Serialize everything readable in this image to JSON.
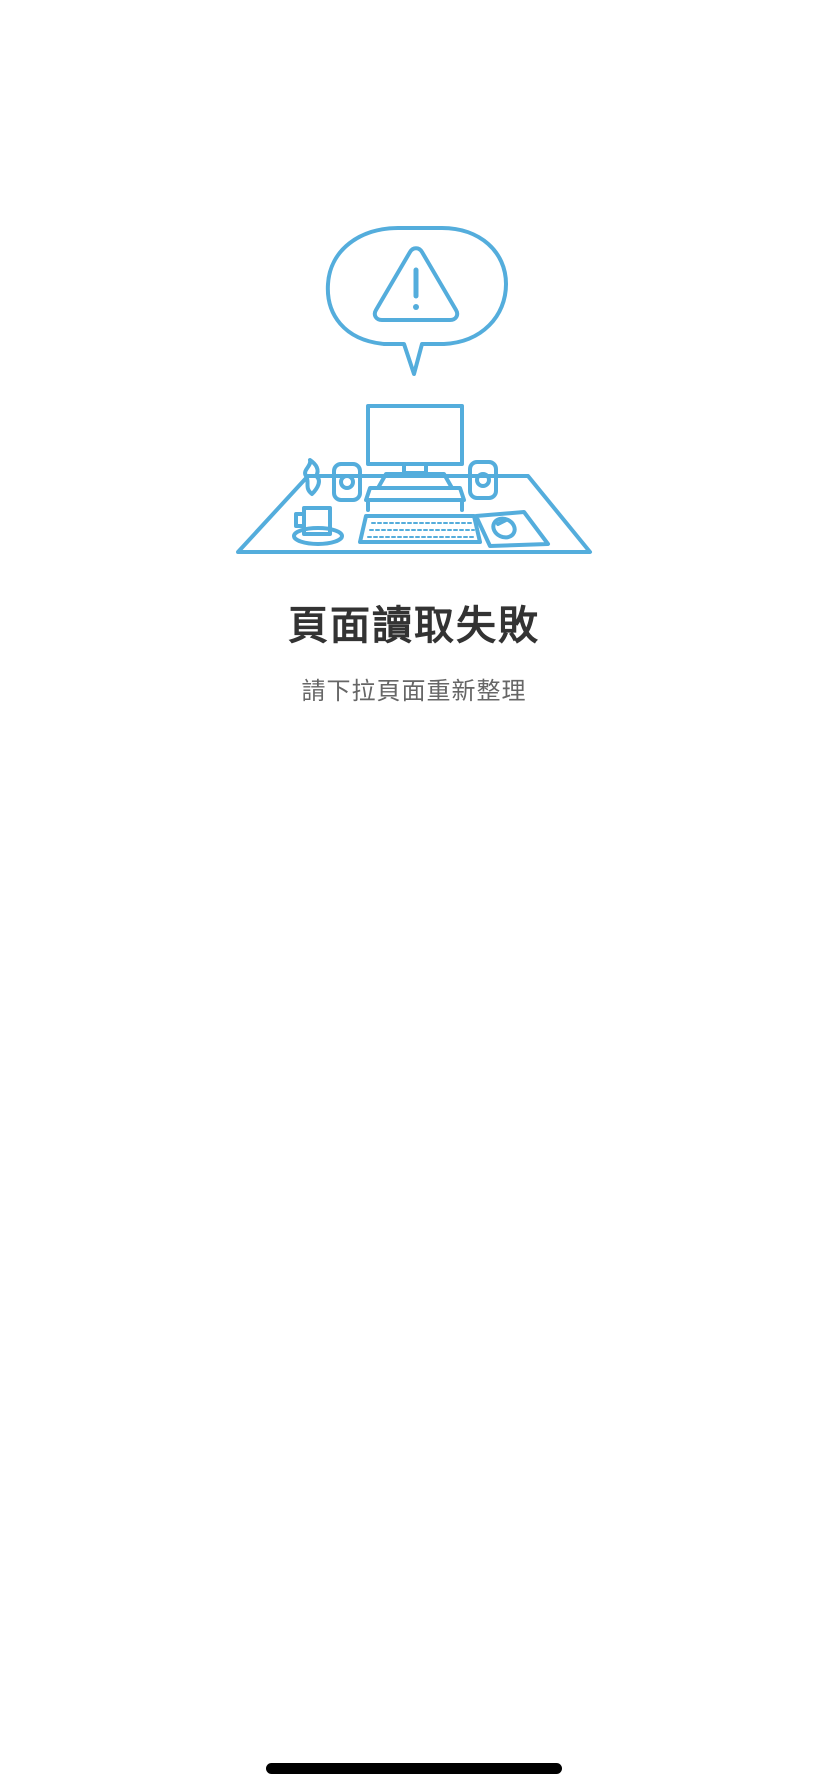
{
  "error": {
    "title": "頁面讀取失敗",
    "subtitle": "請下拉頁面重新整理"
  },
  "illustration": {
    "icon": "desk-warning-illustration",
    "stroke_color": "#54ADDC"
  },
  "colors": {
    "background": "#FFFFFF",
    "title": "#333333",
    "subtitle": "#666666",
    "home_indicator": "#000000"
  }
}
